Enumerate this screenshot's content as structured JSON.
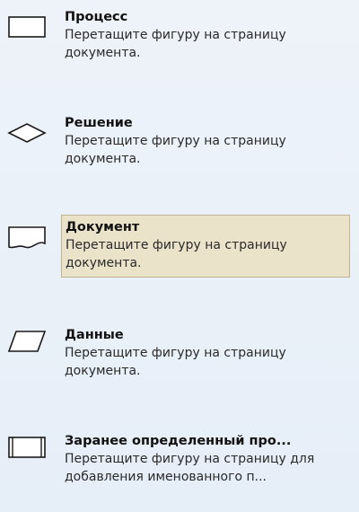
{
  "shapes": [
    {
      "title": "Процесс",
      "description": "Перетащите фигуру на страницу документа.",
      "icon": "process-rectangle-icon",
      "selected": false
    },
    {
      "title": "Решение",
      "description": "Перетащите фигуру на страницу документа.",
      "icon": "decision-diamond-icon",
      "selected": false
    },
    {
      "title": "Документ",
      "description": "Перетащите фигуру на страницу документа.",
      "icon": "document-shape-icon",
      "selected": true
    },
    {
      "title": "Данные",
      "description": "Перетащите фигуру на страницу документа.",
      "icon": "data-parallelogram-icon",
      "selected": false
    },
    {
      "title": "Заранее определенный про...",
      "description": "Перетащите фигуру на страницу для добавления именованного п...",
      "icon": "predefined-process-icon",
      "selected": false
    }
  ],
  "colors": {
    "background": "#e6eef8",
    "selected_background": "#eae2c9",
    "selected_border": "#bfb394",
    "shape_stroke": "#1a1a1a"
  }
}
